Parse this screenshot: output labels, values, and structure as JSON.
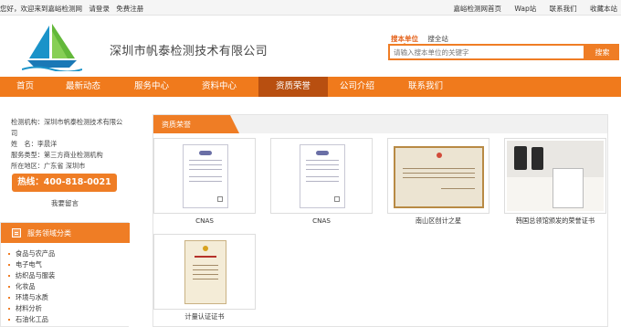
{
  "topbar": {
    "welcome": "您好，欢迎来到嘉峪检测网",
    "login": "请登录",
    "register": "免费注册",
    "links": [
      "嘉峪检测网首页",
      "Wap站",
      "联系我们",
      "收藏本站"
    ]
  },
  "header": {
    "company_name": "深圳市帆泰检测技术有限公司"
  },
  "search": {
    "tabs": [
      "搜本单位",
      "搜全站"
    ],
    "active_tab": "搜本单位",
    "placeholder": "请输入搜本单位的关键字",
    "button": "搜索"
  },
  "nav": {
    "items": [
      "首页",
      "最新动态",
      "服务中心",
      "资料中心",
      "资质荣誉",
      "公司介绍",
      "联系我们"
    ],
    "active": "资质荣誉"
  },
  "sidebar": {
    "info": {
      "org_label": "检测机构：",
      "org_value": "深圳市帆泰检测技术有限公司",
      "name_label": "姓　名：",
      "name_value": "李晨洋",
      "type_label": "服务类型：",
      "type_value": "第三方商业检测机构",
      "region_label": "所在地区：",
      "region_value": "广东省 深圳市"
    },
    "hotline": "热线：400-818-0021",
    "leave_message": "我要留言",
    "service_title": "服务领域分类",
    "service_items": [
      "食品与农产品",
      "电子电气",
      "纺织品与服装",
      "化妆品",
      "环境与水质",
      "材料分析",
      "石油化工品"
    ]
  },
  "main": {
    "section_title": "资质荣誉",
    "certificates": [
      {
        "caption": "CNAS"
      },
      {
        "caption": "CNAS"
      },
      {
        "caption": "南山区创计之星"
      },
      {
        "caption": "韩国总领馆颁发的荣誉证书"
      },
      {
        "caption": "计量认证证书"
      }
    ]
  },
  "colors": {
    "accent": "#ef7d25",
    "nav_active": "#b84f10"
  }
}
